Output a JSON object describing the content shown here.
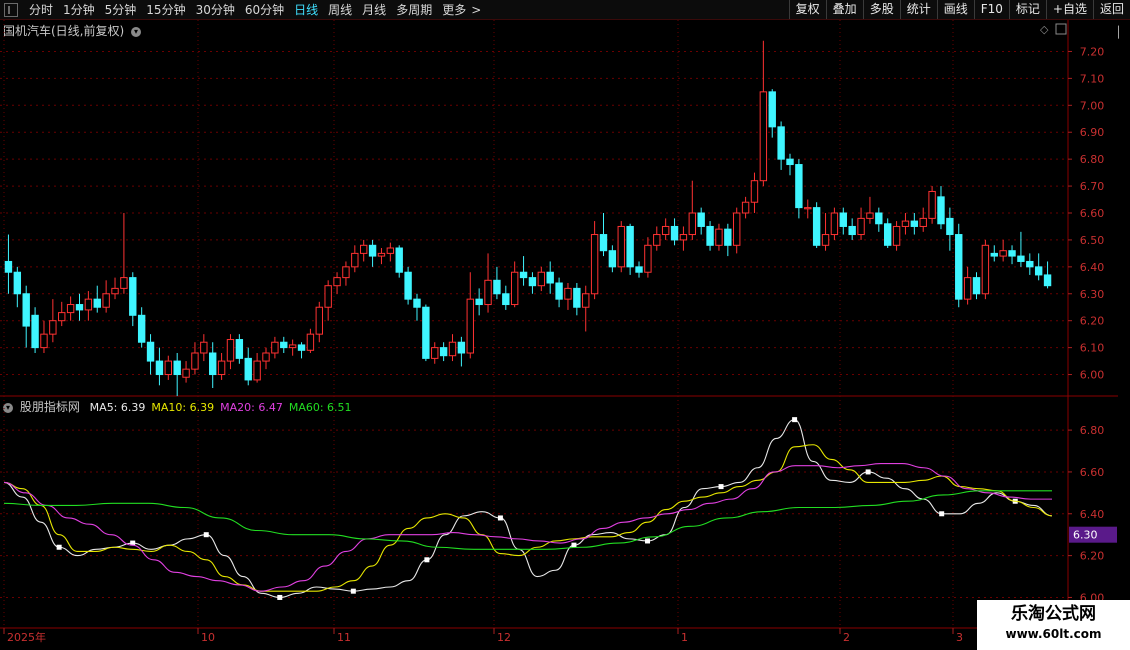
{
  "toolbar": {
    "periods": [
      "分时",
      "1分钟",
      "5分钟",
      "15分钟",
      "30分钟",
      "60分钟",
      "日线",
      "周线",
      "月线",
      "多周期",
      "更多"
    ],
    "active_period": "日线",
    "right_buttons": [
      "复权",
      "叠加",
      "多股",
      "统计",
      "画线",
      "F10",
      "标记",
      "+自选",
      "返回"
    ]
  },
  "main_chart": {
    "title": "国机汽车(日线,前复权)",
    "y_ticks": [
      "7.20",
      "7.10",
      "7.00",
      "6.90",
      "6.80",
      "6.70",
      "6.60",
      "6.50",
      "6.40",
      "6.30",
      "6.20",
      "6.10",
      "6.00"
    ]
  },
  "indicator": {
    "name": "股朋指标网",
    "ma_labels": [
      {
        "text": "MA5: 6.39",
        "color": "#e8e8e8"
      },
      {
        "text": "MA10: 6.39",
        "color": "#e6e600"
      },
      {
        "text": "MA20: 6.47",
        "color": "#e040e0"
      },
      {
        "text": "MA60: 6.51",
        "color": "#22dd22"
      }
    ],
    "y_ticks": [
      "6.80",
      "6.60",
      "6.40",
      "6.20",
      "6.00"
    ],
    "current_value": "6.30"
  },
  "x_axis": {
    "labels": [
      "2025年",
      "10",
      "11",
      "12",
      "1",
      "2",
      "3"
    ]
  },
  "watermark": {
    "line1": "乐淘公式网",
    "line2": "www.60lt.com"
  },
  "colors": {
    "up": "#ff3232",
    "down": "#3ff5ff",
    "grid": "#6a0000",
    "ma5": "#e8e8e8",
    "ma10": "#e6e600",
    "ma20": "#e040e0",
    "ma60": "#22dd22",
    "badge": "#5a1a8a"
  },
  "chart_data": {
    "type": "candlestick",
    "price_range": [
      5.95,
      7.25
    ],
    "candles": [
      [
        6.42,
        6.38,
        6.52,
        6.3
      ],
      [
        6.38,
        6.3,
        6.4,
        6.25
      ],
      [
        6.3,
        6.18,
        6.33,
        6.1
      ],
      [
        6.22,
        6.1,
        6.25,
        6.08
      ],
      [
        6.1,
        6.15,
        6.2,
        6.08
      ],
      [
        6.15,
        6.2,
        6.28,
        6.12
      ],
      [
        6.2,
        6.23,
        6.27,
        6.18
      ],
      [
        6.23,
        6.26,
        6.29,
        6.2
      ],
      [
        6.26,
        6.24,
        6.3,
        6.2
      ],
      [
        6.24,
        6.28,
        6.31,
        6.2
      ],
      [
        6.28,
        6.25,
        6.33,
        6.23
      ],
      [
        6.25,
        6.3,
        6.35,
        6.23
      ],
      [
        6.3,
        6.32,
        6.36,
        6.28
      ],
      [
        6.32,
        6.36,
        6.6,
        6.3
      ],
      [
        6.36,
        6.22,
        6.38,
        6.18
      ],
      [
        6.22,
        6.12,
        6.25,
        6.1
      ],
      [
        6.12,
        6.05,
        6.15,
        6.0
      ],
      [
        6.05,
        6.0,
        6.1,
        5.96
      ],
      [
        6.0,
        6.05,
        6.07,
        5.98
      ],
      [
        6.05,
        6.0,
        6.08,
        5.92
      ],
      [
        5.99,
        6.02,
        6.05,
        5.97
      ],
      [
        6.02,
        6.08,
        6.12,
        6.0
      ],
      [
        6.08,
        6.12,
        6.15,
        6.05
      ],
      [
        6.08,
        6.0,
        6.12,
        5.95
      ],
      [
        6.0,
        6.05,
        6.08,
        5.98
      ],
      [
        6.05,
        6.13,
        6.15,
        6.02
      ],
      [
        6.13,
        6.06,
        6.15,
        6.04
      ],
      [
        6.06,
        5.98,
        6.1,
        5.96
      ],
      [
        5.98,
        6.05,
        6.08,
        5.97
      ],
      [
        6.05,
        6.08,
        6.1,
        6.02
      ],
      [
        6.08,
        6.12,
        6.14,
        6.06
      ],
      [
        6.12,
        6.1,
        6.14,
        6.08
      ],
      [
        6.1,
        6.11,
        6.13,
        6.07
      ],
      [
        6.11,
        6.09,
        6.12,
        6.06
      ],
      [
        6.09,
        6.15,
        6.17,
        6.08
      ],
      [
        6.15,
        6.25,
        6.27,
        6.12
      ],
      [
        6.25,
        6.33,
        6.35,
        6.2
      ],
      [
        6.33,
        6.36,
        6.38,
        6.3
      ],
      [
        6.36,
        6.4,
        6.42,
        6.33
      ],
      [
        6.4,
        6.45,
        6.48,
        6.38
      ],
      [
        6.45,
        6.48,
        6.5,
        6.42
      ],
      [
        6.48,
        6.44,
        6.5,
        6.4
      ],
      [
        6.44,
        6.45,
        6.47,
        6.41
      ],
      [
        6.45,
        6.47,
        6.49,
        6.42
      ],
      [
        6.47,
        6.38,
        6.48,
        6.36
      ],
      [
        6.38,
        6.28,
        6.4,
        6.26
      ],
      [
        6.28,
        6.25,
        6.3,
        6.2
      ],
      [
        6.25,
        6.06,
        6.26,
        6.05
      ],
      [
        6.06,
        6.1,
        6.12,
        6.04
      ],
      [
        6.1,
        6.07,
        6.12,
        6.05
      ],
      [
        6.07,
        6.12,
        6.15,
        6.05
      ],
      [
        6.12,
        6.08,
        6.14,
        6.03
      ],
      [
        6.08,
        6.28,
        6.38,
        6.06
      ],
      [
        6.28,
        6.26,
        6.32,
        6.22
      ],
      [
        6.26,
        6.35,
        6.45,
        6.23
      ],
      [
        6.35,
        6.3,
        6.4,
        6.28
      ],
      [
        6.3,
        6.26,
        6.33,
        6.24
      ],
      [
        6.26,
        6.38,
        6.42,
        6.25
      ],
      [
        6.38,
        6.36,
        6.44,
        6.33
      ],
      [
        6.36,
        6.33,
        6.38,
        6.3
      ],
      [
        6.33,
        6.38,
        6.4,
        6.31
      ],
      [
        6.38,
        6.34,
        6.42,
        6.3
      ],
      [
        6.34,
        6.28,
        6.36,
        6.25
      ],
      [
        6.28,
        6.32,
        6.34,
        6.24
      ],
      [
        6.32,
        6.25,
        6.34,
        6.22
      ],
      [
        6.25,
        6.3,
        6.33,
        6.16
      ],
      [
        6.3,
        6.52,
        6.57,
        6.28
      ],
      [
        6.52,
        6.46,
        6.6,
        6.44
      ],
      [
        6.46,
        6.4,
        6.48,
        6.38
      ],
      [
        6.4,
        6.55,
        6.57,
        6.38
      ],
      [
        6.55,
        6.4,
        6.56,
        6.37
      ],
      [
        6.4,
        6.38,
        6.42,
        6.36
      ],
      [
        6.38,
        6.48,
        6.51,
        6.36
      ],
      [
        6.48,
        6.52,
        6.55,
        6.46
      ],
      [
        6.52,
        6.55,
        6.58,
        6.5
      ],
      [
        6.55,
        6.5,
        6.58,
        6.48
      ],
      [
        6.5,
        6.52,
        6.55,
        6.46
      ],
      [
        6.52,
        6.6,
        6.72,
        6.5
      ],
      [
        6.6,
        6.55,
        6.62,
        6.52
      ],
      [
        6.55,
        6.48,
        6.57,
        6.46
      ],
      [
        6.48,
        6.54,
        6.56,
        6.46
      ],
      [
        6.54,
        6.48,
        6.56,
        6.44
      ],
      [
        6.48,
        6.6,
        6.62,
        6.45
      ],
      [
        6.6,
        6.64,
        6.66,
        6.58
      ],
      [
        6.64,
        6.72,
        6.75,
        6.6
      ],
      [
        6.72,
        7.05,
        7.24,
        6.7
      ],
      [
        7.05,
        6.92,
        7.06,
        6.88
      ],
      [
        6.92,
        6.8,
        6.94,
        6.76
      ],
      [
        6.8,
        6.78,
        6.82,
        6.74
      ],
      [
        6.78,
        6.62,
        6.8,
        6.58
      ],
      [
        6.62,
        6.62,
        6.65,
        6.58
      ],
      [
        6.62,
        6.48,
        6.64,
        6.47
      ],
      [
        6.48,
        6.52,
        6.6,
        6.46
      ],
      [
        6.52,
        6.6,
        6.62,
        6.5
      ],
      [
        6.6,
        6.55,
        6.62,
        6.52
      ],
      [
        6.55,
        6.52,
        6.58,
        6.5
      ],
      [
        6.52,
        6.58,
        6.62,
        6.5
      ],
      [
        6.58,
        6.6,
        6.66,
        6.56
      ],
      [
        6.6,
        6.56,
        6.62,
        6.53
      ],
      [
        6.56,
        6.48,
        6.58,
        6.47
      ],
      [
        6.48,
        6.55,
        6.57,
        6.46
      ],
      [
        6.55,
        6.57,
        6.6,
        6.52
      ],
      [
        6.57,
        6.55,
        6.6,
        6.52
      ],
      [
        6.55,
        6.58,
        6.62,
        6.53
      ],
      [
        6.58,
        6.68,
        6.7,
        6.56
      ],
      [
        6.66,
        6.56,
        6.7,
        6.54
      ],
      [
        6.58,
        6.52,
        6.62,
        6.46
      ],
      [
        6.52,
        6.28,
        6.56,
        6.25
      ],
      [
        6.28,
        6.36,
        6.4,
        6.26
      ],
      [
        6.36,
        6.3,
        6.38,
        6.28
      ],
      [
        6.3,
        6.48,
        6.5,
        6.28
      ],
      [
        6.45,
        6.44,
        6.48,
        6.42
      ],
      [
        6.44,
        6.46,
        6.5,
        6.42
      ],
      [
        6.46,
        6.44,
        6.48,
        6.41
      ],
      [
        6.44,
        6.42,
        6.53,
        6.4
      ],
      [
        6.42,
        6.4,
        6.45,
        6.37
      ],
      [
        6.4,
        6.37,
        6.45,
        6.35
      ],
      [
        6.37,
        6.33,
        6.42,
        6.32
      ]
    ],
    "indicator_range": [
      5.94,
      6.92
    ],
    "indicator_series": [
      {
        "name": "MA5",
        "color": "#e8e8e8",
        "values": [
          6.55,
          6.48,
          6.36,
          6.24,
          6.2,
          6.23,
          6.24,
          6.26,
          6.23,
          6.25,
          6.28,
          6.3,
          6.2,
          6.1,
          6.02,
          6.0,
          6.02,
          6.05,
          6.04,
          6.03,
          6.04,
          6.05,
          6.08,
          6.18,
          6.3,
          6.39,
          6.41,
          6.38,
          6.23,
          6.1,
          6.13,
          6.25,
          6.3,
          6.31,
          6.28,
          6.27,
          6.3,
          6.43,
          6.52,
          6.53,
          6.55,
          6.62,
          6.76,
          6.85,
          6.65,
          6.56,
          6.55,
          6.6,
          6.57,
          6.52,
          6.47,
          6.4,
          6.4,
          6.45,
          6.5,
          6.46,
          6.44,
          6.39
        ]
      },
      {
        "name": "MA10",
        "color": "#e6e600",
        "values": [
          6.55,
          6.52,
          6.44,
          6.3,
          6.22,
          6.22,
          6.24,
          6.23,
          6.22,
          6.25,
          6.22,
          6.18,
          6.1,
          6.06,
          6.03,
          6.03,
          6.03,
          6.03,
          6.05,
          6.08,
          6.15,
          6.25,
          6.33,
          6.38,
          6.4,
          6.38,
          6.3,
          6.21,
          6.2,
          6.24,
          6.27,
          6.28,
          6.29,
          6.29,
          6.31,
          6.36,
          6.42,
          6.46,
          6.48,
          6.5,
          6.53,
          6.56,
          6.6,
          6.72,
          6.73,
          6.66,
          6.61,
          6.55,
          6.55,
          6.55,
          6.56,
          6.58,
          6.53,
          6.52,
          6.51,
          6.46,
          6.43,
          6.39
        ]
      },
      {
        "name": "MA20",
        "color": "#e040e0",
        "values": [
          6.55,
          6.5,
          6.44,
          6.38,
          6.35,
          6.3,
          6.25,
          6.18,
          6.12,
          6.1,
          6.08,
          6.06,
          6.03,
          6.05,
          6.08,
          6.15,
          6.22,
          6.28,
          6.3,
          6.3,
          6.3,
          6.31,
          6.3,
          6.29,
          6.28,
          6.27,
          6.26,
          6.28,
          6.33,
          6.36,
          6.38,
          6.4,
          6.42,
          6.45,
          6.47,
          6.52,
          6.6,
          6.63,
          6.63,
          6.62,
          6.63,
          6.64,
          6.64,
          6.62,
          6.58,
          6.52,
          6.5,
          6.48,
          6.47,
          6.47
        ]
      },
      {
        "name": "MA60",
        "color": "#22dd22",
        "values": [
          6.45,
          6.44,
          6.44,
          6.45,
          6.45,
          6.43,
          6.38,
          6.32,
          6.3,
          6.3,
          6.28,
          6.27,
          6.24,
          6.23,
          6.23,
          6.23,
          6.24,
          6.26,
          6.29,
          6.34,
          6.38,
          6.41,
          6.43,
          6.43,
          6.44,
          6.46,
          6.49,
          6.51,
          6.51,
          6.51
        ]
      }
    ]
  }
}
